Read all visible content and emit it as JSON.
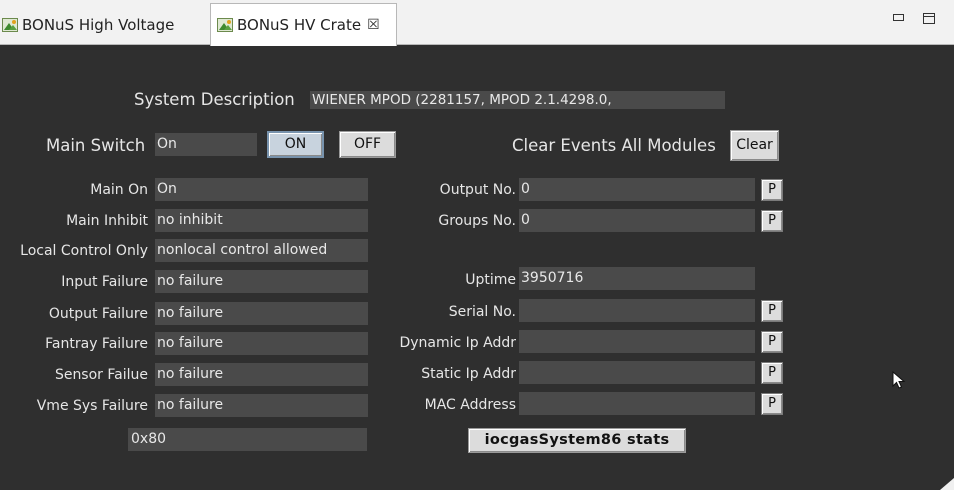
{
  "tabs": [
    {
      "label": "BONuS High Voltage",
      "icon": "image-icon"
    },
    {
      "label": "BONuS HV Crate",
      "icon": "image-icon",
      "close": "☒"
    }
  ],
  "system": {
    "description_label": "System Description",
    "description_value": "WIENER MPOD (2281157, MPOD 2.1.4298.0,"
  },
  "main_switch": {
    "label": "Main Switch",
    "value": "On",
    "on_label": "ON",
    "off_label": "OFF"
  },
  "clear_events": {
    "label": "Clear Events All Modules",
    "button_label": "Clear"
  },
  "status": [
    {
      "label": "Main On",
      "value": "On"
    },
    {
      "label": "Main Inhibit",
      "value": "no inhibit"
    },
    {
      "label": "Local Control Only",
      "value": "nonlocal control allowed"
    },
    {
      "label": "Input Failure",
      "value": "no failure"
    },
    {
      "label": "Output Failure",
      "value": "no failure"
    },
    {
      "label": "Fantray Failure",
      "value": "no failure"
    },
    {
      "label": "Sensor Failue",
      "value": "no failure"
    },
    {
      "label": "Vme Sys Failure",
      "value": "no failure"
    }
  ],
  "hex_value": "0x80",
  "info": {
    "output_no": {
      "label": "Output No.",
      "value": "0",
      "p": "P"
    },
    "groups_no": {
      "label": "Groups No.",
      "value": "0",
      "p": "P"
    },
    "uptime": {
      "label": "Uptime",
      "value": "3950716"
    },
    "serial_no": {
      "label": "Serial No.",
      "value": "",
      "p": "P"
    },
    "dynamic_ip": {
      "label": "Dynamic Ip Addr",
      "value": "",
      "p": "P"
    },
    "static_ip": {
      "label": "Static Ip Addr",
      "value": "",
      "p": "P"
    },
    "mac": {
      "label": "MAC Address",
      "value": "",
      "p": "P"
    }
  },
  "stats_button": "iocgasSystem86 stats"
}
